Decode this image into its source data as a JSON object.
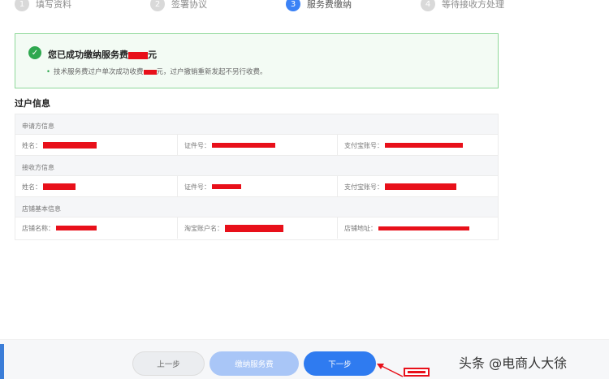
{
  "steps": [
    {
      "num": "1",
      "label": "填写资料"
    },
    {
      "num": "2",
      "label": "签署协议"
    },
    {
      "num": "3",
      "label": "服务费缴纳"
    },
    {
      "num": "4",
      "label": "等待接收方处理"
    }
  ],
  "success": {
    "title_prefix": "您已成功缴纳服务费",
    "title_suffix": "元",
    "sub_prefix": "技术服务费过户单次成功收费",
    "sub_suffix": "元，过户撤销重新发起不另行收费。"
  },
  "section_title": "过户信息",
  "groups": {
    "applicant": "申请方信息",
    "receiver": "接收方信息",
    "shop": "店铺基本信息"
  },
  "fields": {
    "name": "姓名：",
    "id_no": "证件号：",
    "alipay": "支付宝账号：",
    "shop_name": "店铺名称：",
    "taobao_account": "淘宝账户名：",
    "shop_url": "店铺地址："
  },
  "buttons": {
    "prev": "上一步",
    "pay": "缴纳服务费",
    "next": "下一步"
  },
  "watermark": "头条 @电商人大徐",
  "colors": {
    "accent": "#2f7bf0",
    "success": "#2fa84f",
    "redaction": "#e8101a"
  }
}
